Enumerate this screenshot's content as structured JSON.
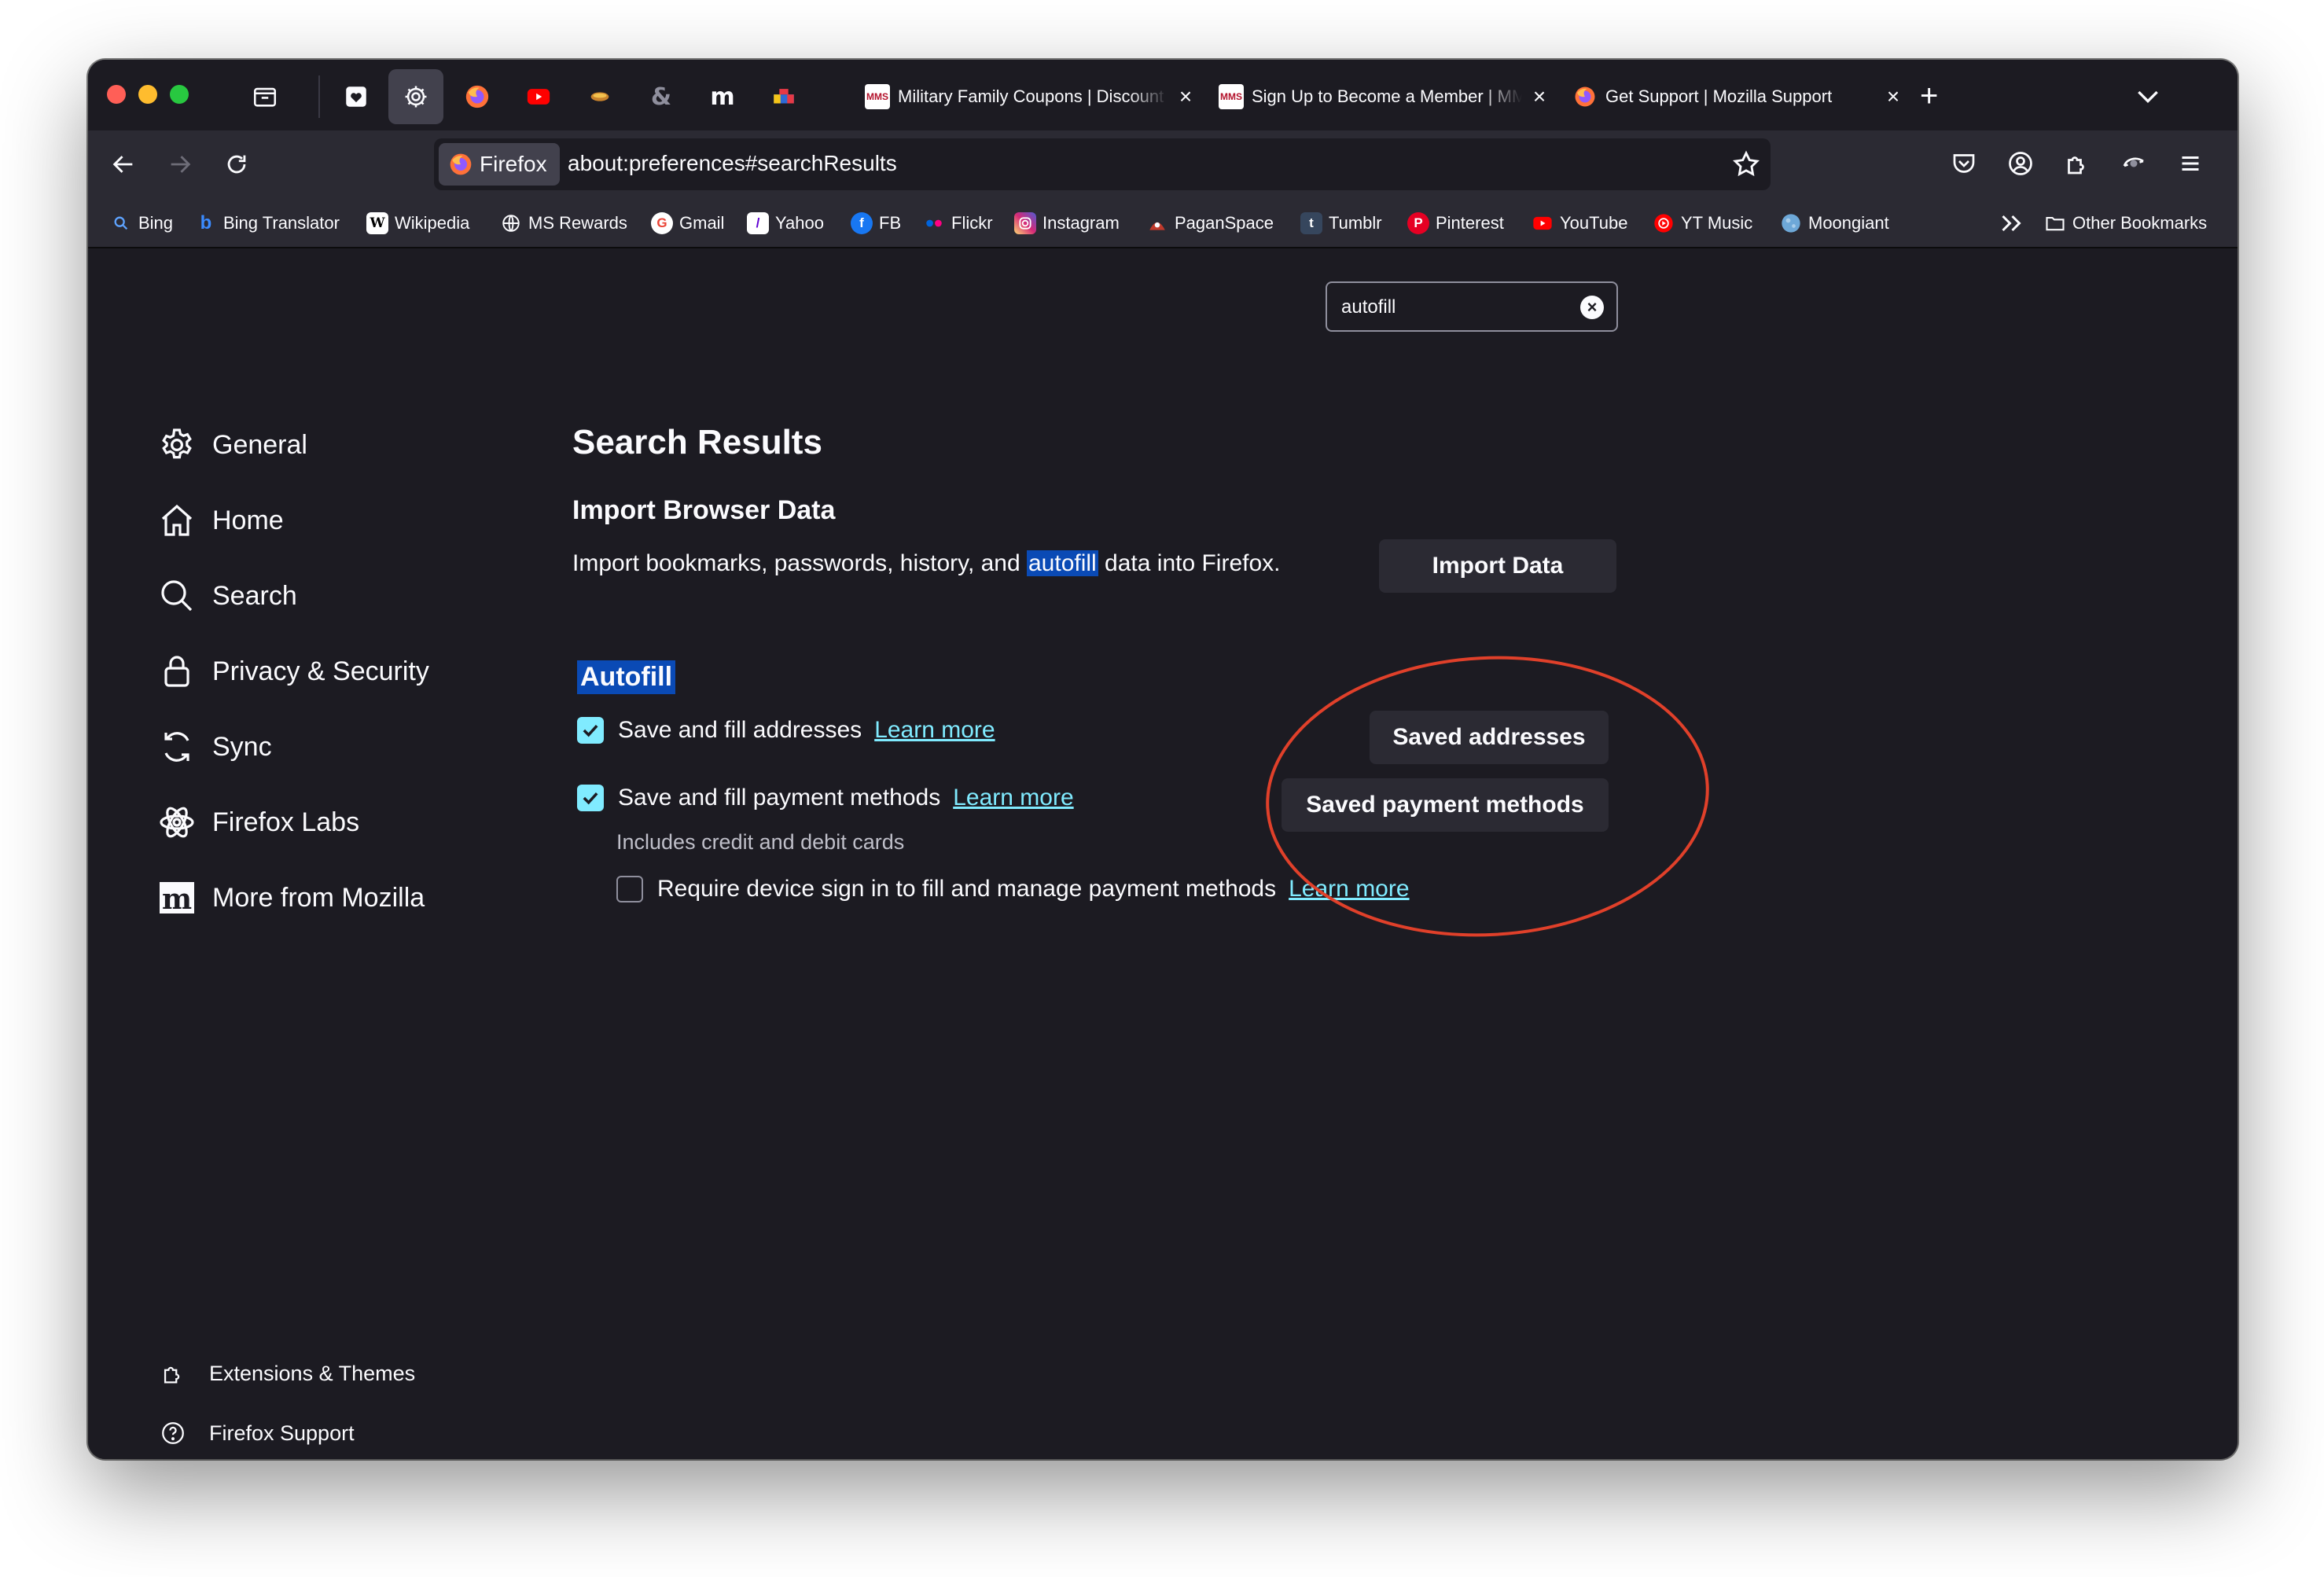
{
  "tabs": {
    "open": [
      {
        "title": "Military Family Coupons | Discount",
        "favicon": "mms-logo-icon"
      },
      {
        "title": "Sign Up to Become a Member | MMS",
        "favicon": "mms-logo-icon"
      },
      {
        "title": "Get Support | Mozilla Support",
        "favicon": "firefox-logo-icon"
      }
    ],
    "pinned": [
      "archive-icon",
      "pocket-heart-icon",
      "settings-gear-icon",
      "firefox-icon",
      "youtube-icon",
      "bowl-icon",
      "ampersand-icon",
      "medium-icon",
      "game-icon"
    ]
  },
  "navbar": {
    "identity_label": "Firefox",
    "url": "about:preferences#searchResults"
  },
  "bookmarks": [
    {
      "label": "Bing",
      "icon": "search-icon",
      "color": "#5ea3ff"
    },
    {
      "label": "Bing Translator",
      "icon": "bing-icon",
      "color": "#3b8bff"
    },
    {
      "label": "Wikipedia",
      "icon": "wikipedia-icon",
      "color": "#ffffff"
    },
    {
      "label": "MS Rewards",
      "icon": "globe-icon",
      "color": "#fbfbfe"
    },
    {
      "label": "Gmail",
      "icon": "google-icon",
      "color": "#ea4335"
    },
    {
      "label": "Yahoo",
      "icon": "yahoo-icon",
      "color": "#6001d2"
    },
    {
      "label": "FB",
      "icon": "facebook-icon",
      "color": "#1877f2"
    },
    {
      "label": "Flickr",
      "icon": "flickr-icon",
      "color": "#0063dc"
    },
    {
      "label": "Instagram",
      "icon": "instagram-icon",
      "color": "#d62976"
    },
    {
      "label": "PaganSpace",
      "icon": "paganspace-icon",
      "color": "#c0392b"
    },
    {
      "label": "Tumblr",
      "icon": "tumblr-icon",
      "color": "#36465d"
    },
    {
      "label": "Pinterest",
      "icon": "pinterest-icon",
      "color": "#e60023"
    },
    {
      "label": "YouTube",
      "icon": "youtube-icon",
      "color": "#ff0000"
    },
    {
      "label": "YT Music",
      "icon": "ytmusic-icon",
      "color": "#ff0000"
    },
    {
      "label": "Moongiant",
      "icon": "moon-icon",
      "color": "#6ea8d8"
    }
  ],
  "other_bookmarks_label": "Other Bookmarks",
  "search": {
    "value": "autofill"
  },
  "sidebar": {
    "items": [
      {
        "label": "General",
        "icon": "gear-icon"
      },
      {
        "label": "Home",
        "icon": "home-icon"
      },
      {
        "label": "Search",
        "icon": "search-icon"
      },
      {
        "label": "Privacy & Security",
        "icon": "lock-icon"
      },
      {
        "label": "Sync",
        "icon": "sync-icon"
      },
      {
        "label": "Firefox Labs",
        "icon": "labs-icon"
      },
      {
        "label": "More from Mozilla",
        "icon": "mozilla-icon"
      }
    ],
    "footer": [
      {
        "label": "Extensions & Themes",
        "icon": "puzzle-icon"
      },
      {
        "label": "Firefox Support",
        "icon": "help-icon"
      }
    ]
  },
  "main": {
    "title": "Search Results",
    "import": {
      "heading": "Import Browser Data",
      "desc_before": "Import bookmarks, passwords, history, and ",
      "desc_highlight": "autofill",
      "desc_after": " data into Firefox.",
      "button": "Import Data"
    },
    "autofill": {
      "heading": "Autofill",
      "addresses_label": "Save and fill addresses",
      "addresses_checked": true,
      "payment_label": "Save and fill payment methods",
      "payment_checked": true,
      "payment_sub": "Includes credit and debit cards",
      "require_label": "Require device sign in to fill and manage payment methods",
      "require_checked": false,
      "learn_more": "Learn more",
      "saved_addresses_button": "Saved addresses",
      "saved_payment_button": "Saved payment methods"
    }
  },
  "colors": {
    "window_bg": "#1c1b22",
    "toolbar_bg": "#2b2a33",
    "accent": "#80ebff",
    "highlight": "#0a4ab5",
    "annotation": "#e0402a"
  }
}
